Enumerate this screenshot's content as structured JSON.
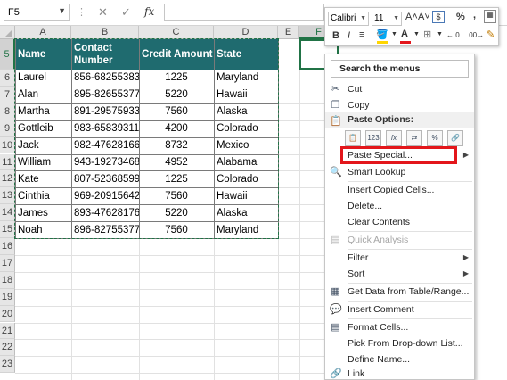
{
  "formula_bar": {
    "name_box": "F5",
    "cancel_icon": "✕",
    "enter_icon": "✓",
    "fx_label": "fx",
    "formula_value": ""
  },
  "columns": [
    "A",
    "B",
    "C",
    "D",
    "E",
    "F"
  ],
  "rows": [
    "5",
    "6",
    "7",
    "8",
    "9",
    "10",
    "11",
    "12",
    "13",
    "14",
    "15",
    "16",
    "17",
    "18",
    "19",
    "20",
    "21",
    "22",
    "23"
  ],
  "table": {
    "headers": [
      "Name",
      "Contact Number",
      "Credit Amount",
      "State"
    ],
    "rows": [
      [
        "Laurel",
        "856-68255383",
        "1225",
        "Maryland"
      ],
      [
        "Alan",
        "895-82655377",
        "5220",
        "Hawaii"
      ],
      [
        "Martha",
        "891-29575933",
        "7560",
        "Alaska"
      ],
      [
        "Gottleib",
        "983-65839311",
        "4200",
        "Colorado"
      ],
      [
        "Jack",
        "982-47628166",
        "8732",
        "Mexico"
      ],
      [
        "William",
        "943-19273468",
        "4952",
        "Alabama"
      ],
      [
        "Kate",
        "807-52368599",
        "1225",
        "Colorado"
      ],
      [
        "Cinthia",
        "969-20915642",
        "7560",
        "Hawaii"
      ],
      [
        "James",
        "893-47628176",
        "5220",
        "Alaska"
      ],
      [
        "Noah",
        "896-82755377",
        "7560",
        "Maryland"
      ]
    ]
  },
  "mini_toolbar": {
    "font_name": "Calibri",
    "font_size": "11",
    "grow_font": "A˄",
    "shrink_font": "A˅",
    "currency": "$",
    "percent": "%",
    "comma": ",",
    "bold": "B",
    "italic": "I",
    "align": "≡",
    "font_color_label": "A",
    "borders": "⊞",
    "inc_decimal": "←.0",
    "dec_decimal": ".00→"
  },
  "context_menu": {
    "search_placeholder": "Search the menus",
    "cut": "Cut",
    "copy": "Copy",
    "paste_options_header": "Paste Options:",
    "paste_option_icons": [
      "paste-icon",
      "paste-values-icon",
      "paste-formulas-icon",
      "paste-transpose-icon",
      "paste-formatting-icon",
      "paste-link-icon"
    ],
    "paste_option_labels": [
      "",
      "123",
      "fx",
      "",
      "%",
      ""
    ],
    "paste_special": "Paste Special...",
    "smart_lookup": "Smart Lookup",
    "insert_copied_cells": "Insert Copied Cells...",
    "delete": "Delete...",
    "clear_contents": "Clear Contents",
    "quick_analysis": "Quick Analysis",
    "filter": "Filter",
    "sort": "Sort",
    "get_data": "Get Data from Table/Range...",
    "insert_comment": "Insert Comment",
    "format_cells": "Format Cells...",
    "pick_from_list": "Pick From Drop-down List...",
    "define_name": "Define Name...",
    "link": "Link"
  },
  "colors": {
    "header_fill": "#1f6b6f",
    "header_text": "#ffffff",
    "selection_green": "#217346",
    "highlight_red": "#e3161b"
  }
}
